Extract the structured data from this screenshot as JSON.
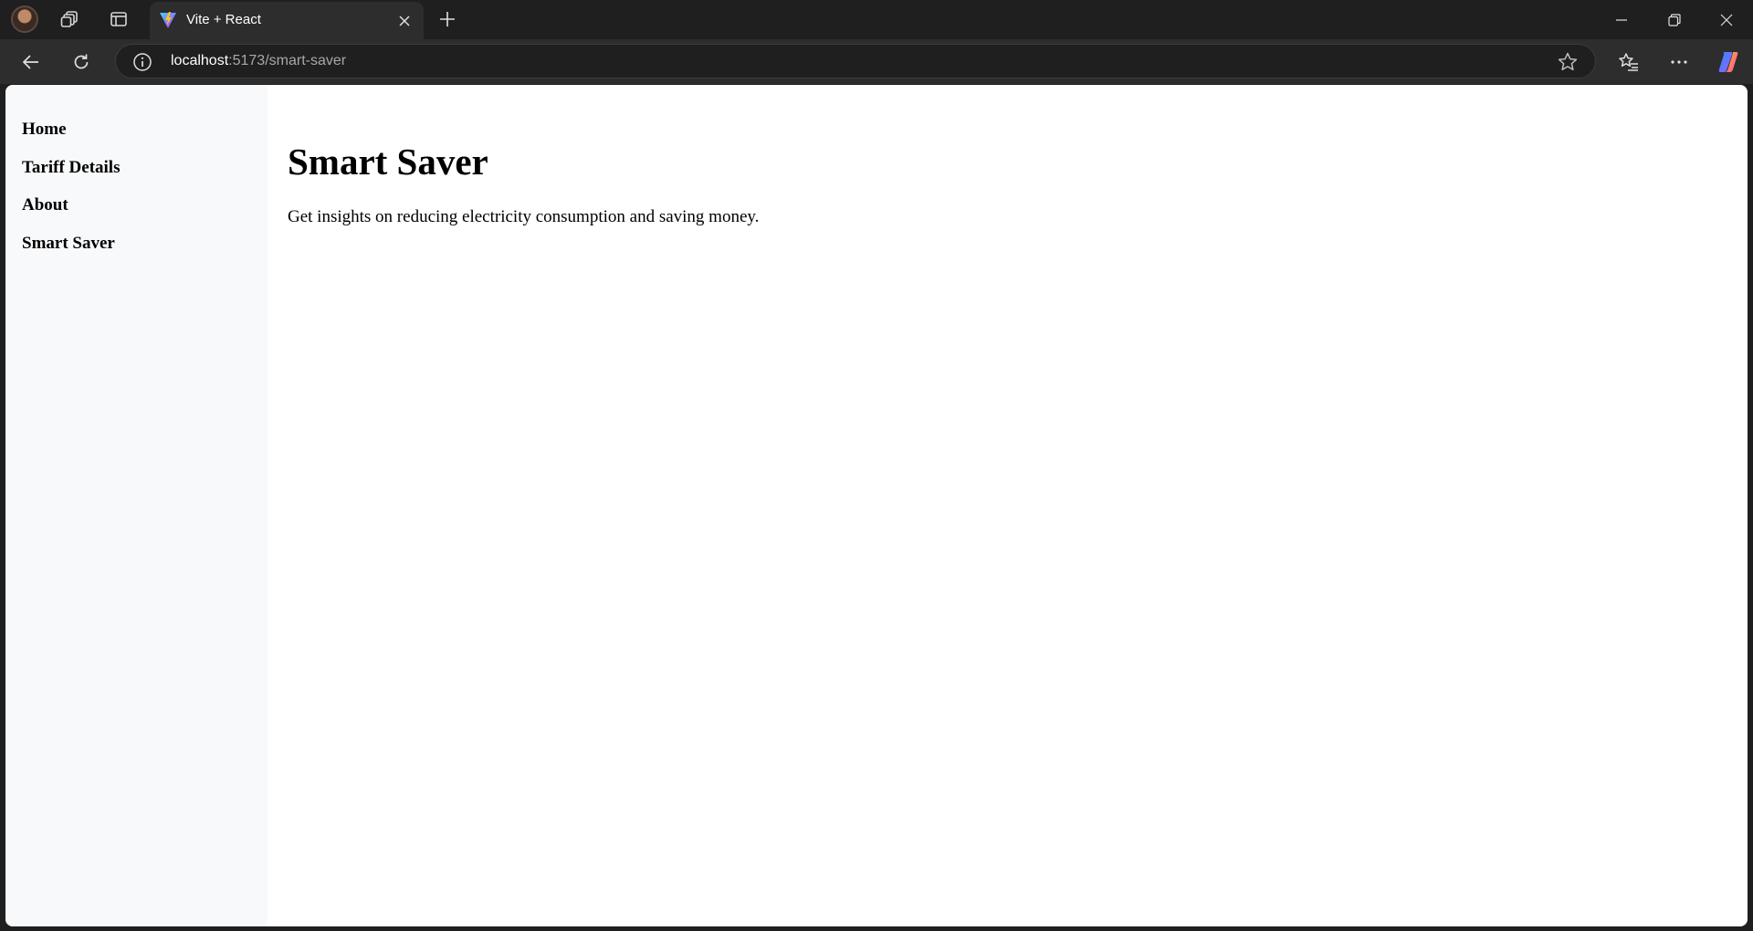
{
  "browser": {
    "tab": {
      "title": "Vite + React"
    },
    "address_bar": {
      "host": "localhost",
      "path": ":5173/smart-saver"
    },
    "icons": {
      "profile": "avatar-icon",
      "workspaces": "workspaces-icon",
      "vertical_tabs": "vertical-tabs-icon",
      "favicon": "vite-logo-icon",
      "tab_close": "close-icon",
      "new_tab": "plus-icon",
      "minimize": "minimize-icon",
      "restore": "restore-icon",
      "close_window": "close-icon",
      "back": "back-arrow-icon",
      "refresh": "refresh-icon",
      "site_info": "info-icon",
      "favorite": "star-icon",
      "favorites": "favorites-icon",
      "more": "more-icon",
      "copilot": "copilot-icon"
    },
    "colors": {
      "tabstrip": "#1f1f1f",
      "toolbar": "#2d2d2d"
    }
  },
  "app": {
    "sidebar": {
      "items": [
        {
          "label": "Home"
        },
        {
          "label": "Tariff Details"
        },
        {
          "label": "About"
        },
        {
          "label": "Smart Saver"
        }
      ]
    },
    "main": {
      "title": "Smart Saver",
      "description": "Get insights on reducing electricity consumption and saving money."
    },
    "colors": {
      "sidebar_bg": "#f8f9fa",
      "content_bg": "#ffffff"
    }
  }
}
